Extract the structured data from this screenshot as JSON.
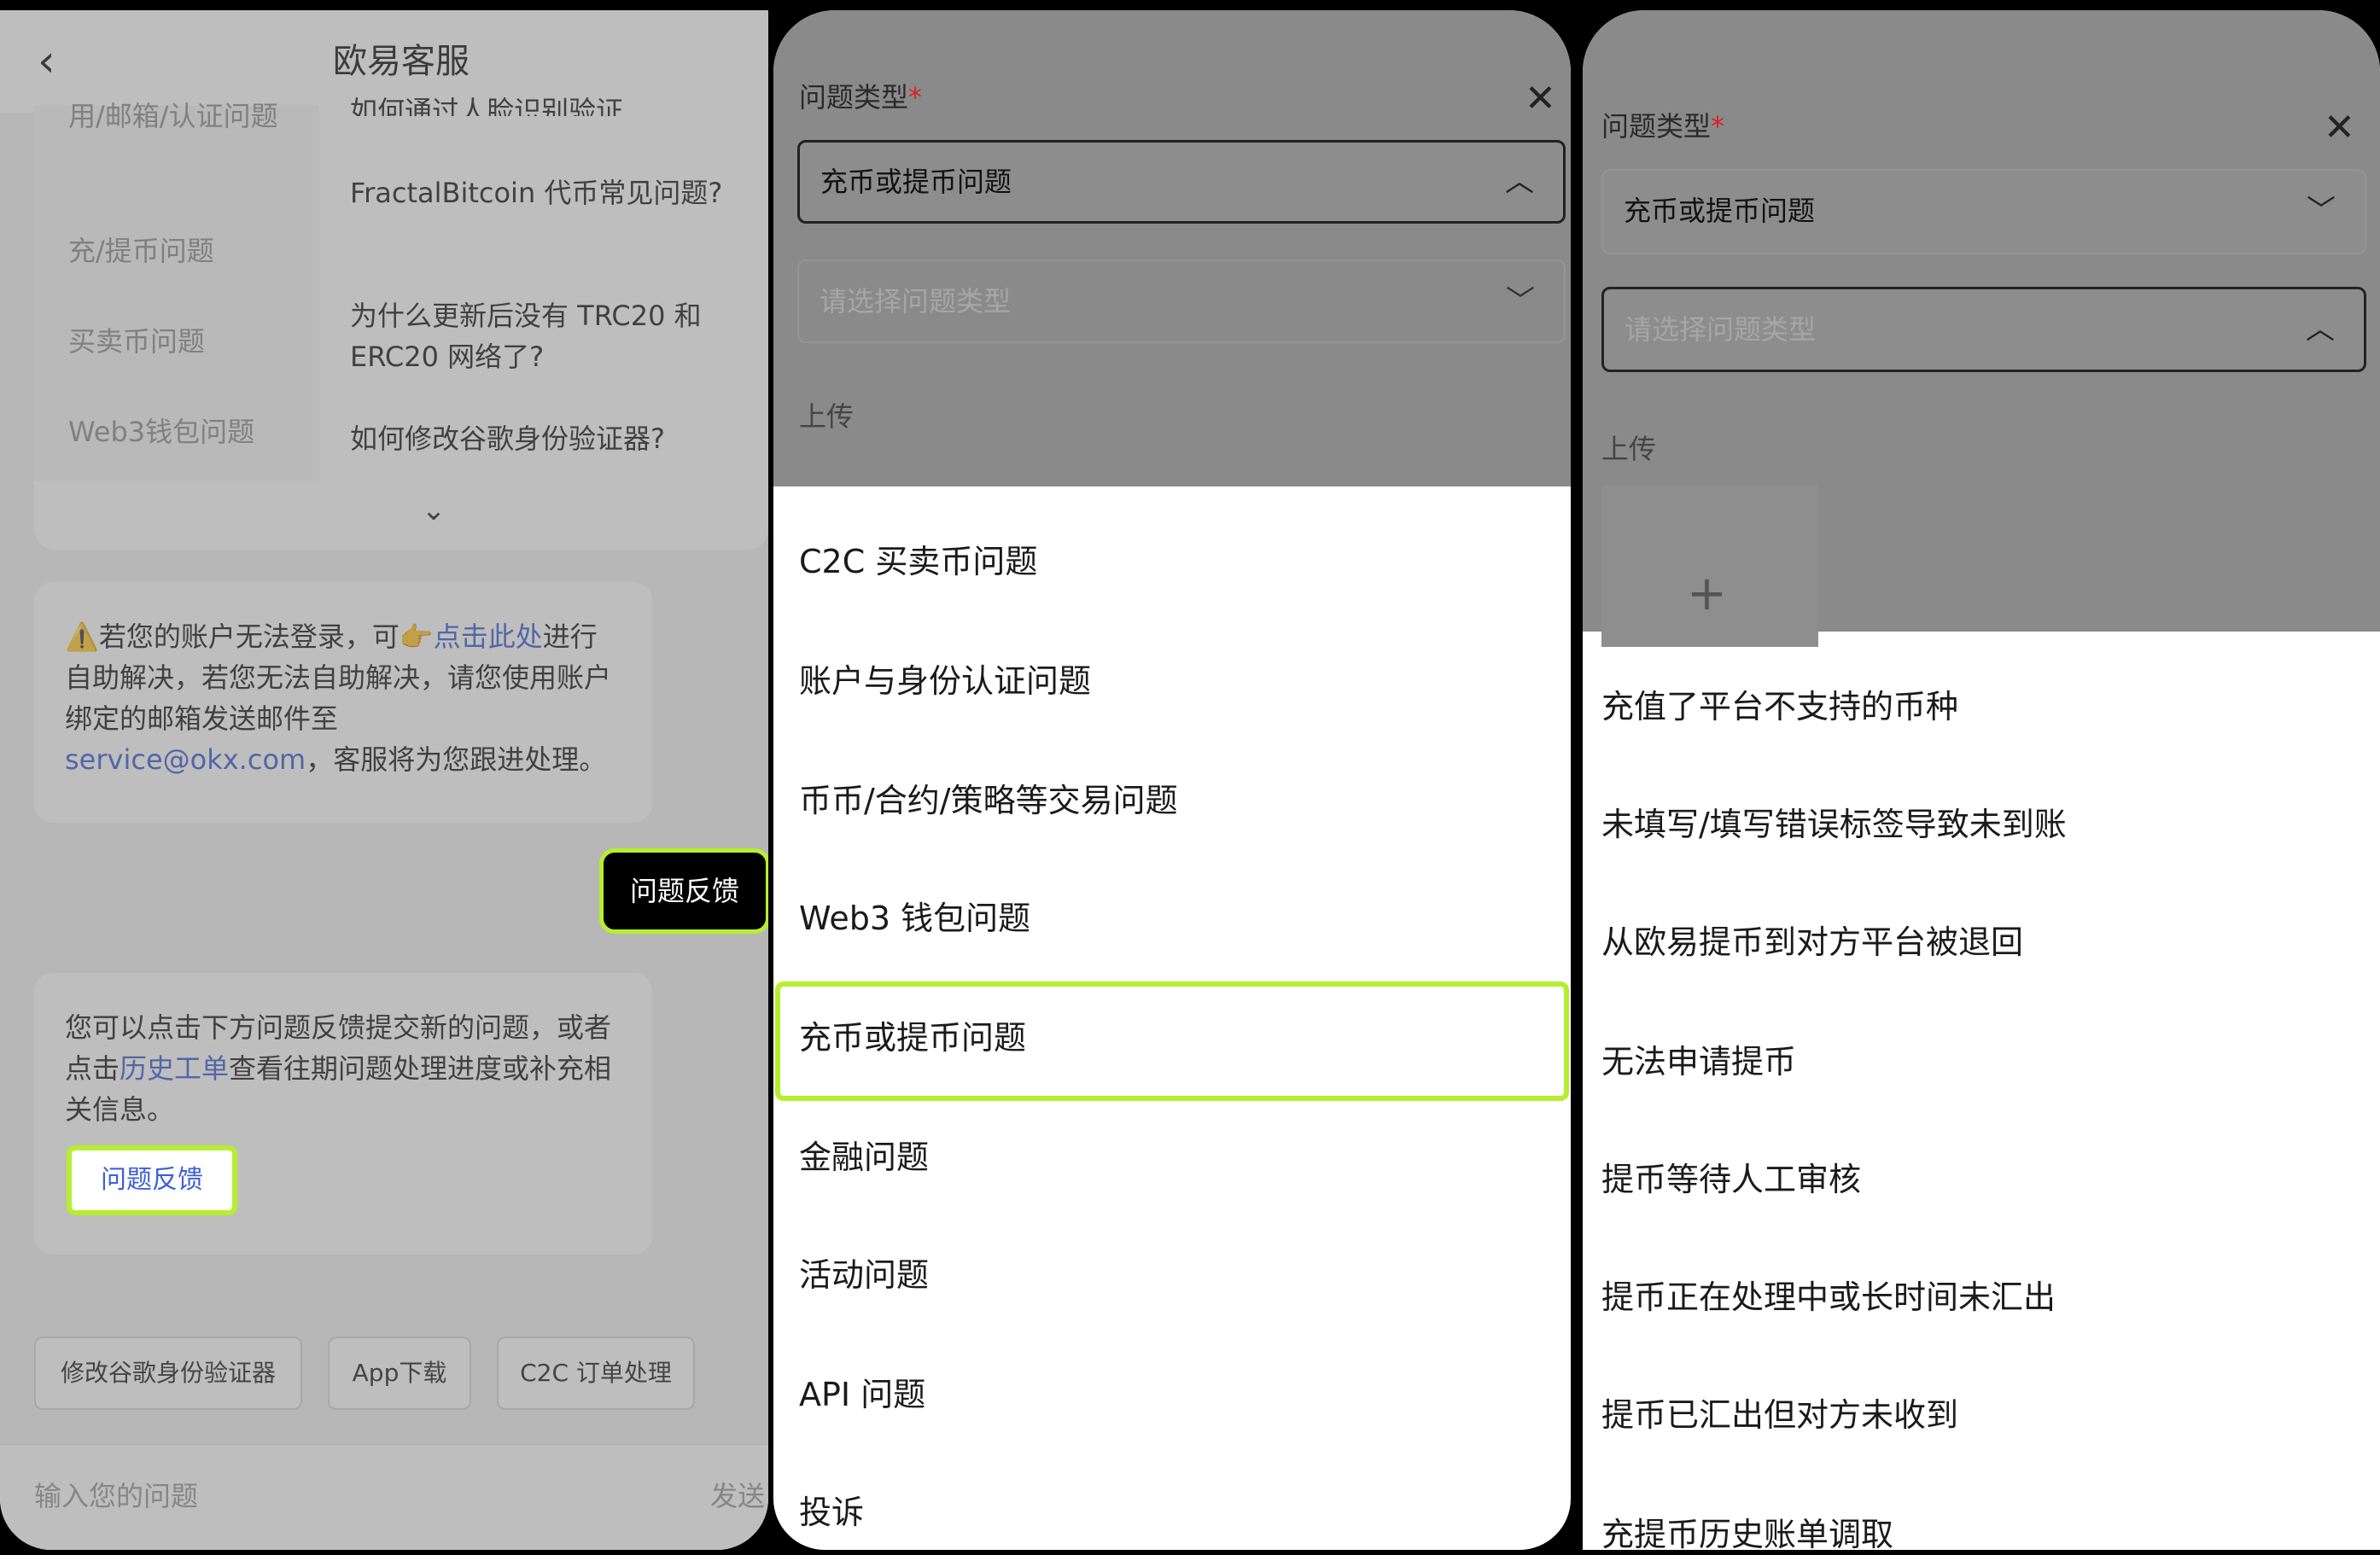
{
  "panel1": {
    "title": "欧易客服",
    "faq_categories": [
      "用/邮箱/认证问题",
      "充/提币问题",
      "买卖币问题",
      "Web3钱包问题"
    ],
    "faq_questions": [
      "如何通过人脸识别验证",
      "FractalBitcoin 代币常见问题?",
      "为什么更新后没有 TRC20 和 ERC20 网络了?",
      "如何修改谷歌身份验证器?"
    ],
    "notice": {
      "warn_icon": "⚠️",
      "text_a": "若您的账户无法登录，可",
      "hand_icon": "👉",
      "link": "点击此处",
      "text_b": "进行自助解决，若您无法自助解决，请您使用账户绑定的邮箱发送邮件至",
      "email": "service@okx.com",
      "text_c": "，客服将为您跟进处理。"
    },
    "user_bubble": "问题反馈",
    "feedback_card": {
      "text_a": "您可以点击下方问题反馈提交新的问题，或者点击",
      "link": "历史工单",
      "text_b": "查看往期问题处理进度或补充相关信息。",
      "button": "问题反馈"
    },
    "quick_chips": [
      "修改谷歌身份验证器",
      "App下载",
      "C2C 订单处理"
    ],
    "input_placeholder": "输入您的问题",
    "send": "发送"
  },
  "panel2": {
    "label": "问题类型",
    "required_mark": "*",
    "selected": "充币或提币问题",
    "sub_placeholder": "请选择问题类型",
    "upload_label": "上传",
    "options": [
      "C2C 买卖币问题",
      "账户与身份认证问题",
      "币币/合约/策略等交易问题",
      "Web3 钱包问题",
      "充币或提币问题",
      "金融问题",
      "活动问题",
      "API 问题",
      "投诉"
    ]
  },
  "panel3": {
    "label": "问题类型",
    "required_mark": "*",
    "selected": "充币或提币问题",
    "sub_placeholder": "请选择问题类型",
    "upload_label": "上传",
    "options": [
      "充值了平台不支持的币种",
      "未填写/填写错误标签导致未到账",
      "从欧易提币到对方平台被退回",
      "无法申请提币",
      "提币等待人工审核",
      "提币正在处理中或长时间未汇出",
      "提币已汇出但对方未收到",
      "充提币历史账单调取"
    ]
  },
  "colors": {
    "highlight": "#b6ef2e",
    "link": "#3b5fd6",
    "required": "#dd2222"
  }
}
